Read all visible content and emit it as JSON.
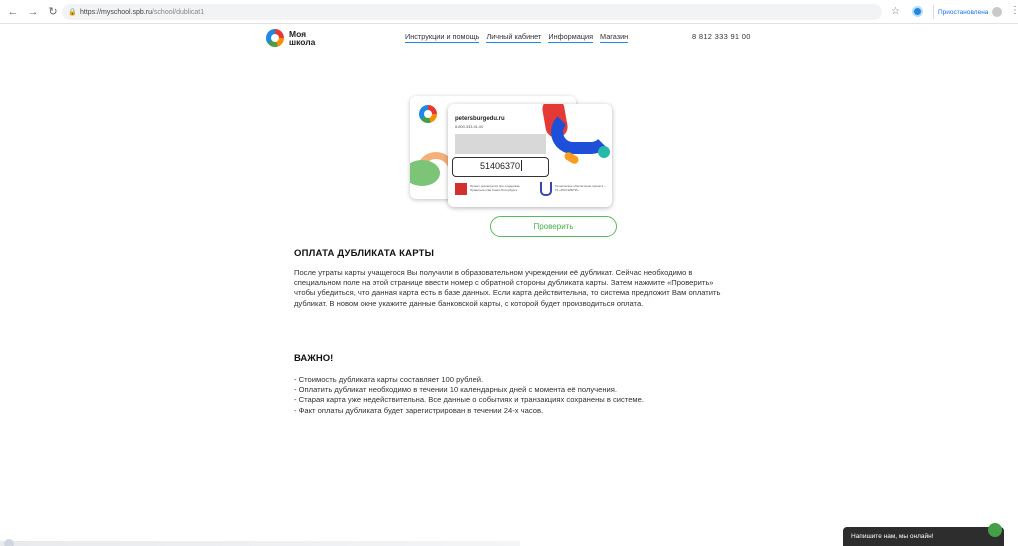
{
  "browser": {
    "url_host": "https://myschool.spb.ru",
    "url_path": "/school/dublicat1",
    "profile_label": "Приостановлена"
  },
  "header": {
    "logo_line1": "Моя",
    "logo_line2": "школа",
    "nav": [
      {
        "label": "Инструкции и помощь"
      },
      {
        "label": "Личный кабинет"
      },
      {
        "label": "Информация"
      },
      {
        "label": "Магазин"
      }
    ],
    "phone": "8 812 333 91 00"
  },
  "card": {
    "site": "petersburgedu.ru",
    "phone": "8-800-333-91-00",
    "number_input_value": "51406370",
    "flag_caption": "Проект реализуется при поддержке Правительства Санкт-Петербурга",
    "emblem_caption": "Техническое обеспечение проекта – ГК «РОСЭЛЬТИ»"
  },
  "check_button_label": "Проверить",
  "section1": {
    "title": "ОПЛАТА ДУБЛИКАТА КАРТЫ",
    "text": "После утраты карты учащегося Вы получили в образовательном учреждении её дубликат. Сейчас необходимо в специальном поле на этой странице ввести номер с обратной стороны дубликата карты. Затем нажмите «Проверить» чтобы убедиться, что данная карта есть в базе данных. Если карта действительна, то система предложит Вам оплатить дубликат. В новом окне укажите данные банковской карты, с которой будет производиться оплата."
  },
  "section2": {
    "title": "ВАЖНО!",
    "items": [
      "- Стоимость дубликата карты составляет 100 рублей.",
      "- Оплатить дубликат необходимо в течении 10 календарных дней с момента её получения.",
      "- Старая карта уже недействительна. Все данные о событиях и транзакциях сохранены в системе.",
      "- Факт оплаты дубликата будет зарегистрирован в течении 24-х часов."
    ]
  },
  "chat": {
    "label": "Напишите нам, мы онлайн!"
  }
}
